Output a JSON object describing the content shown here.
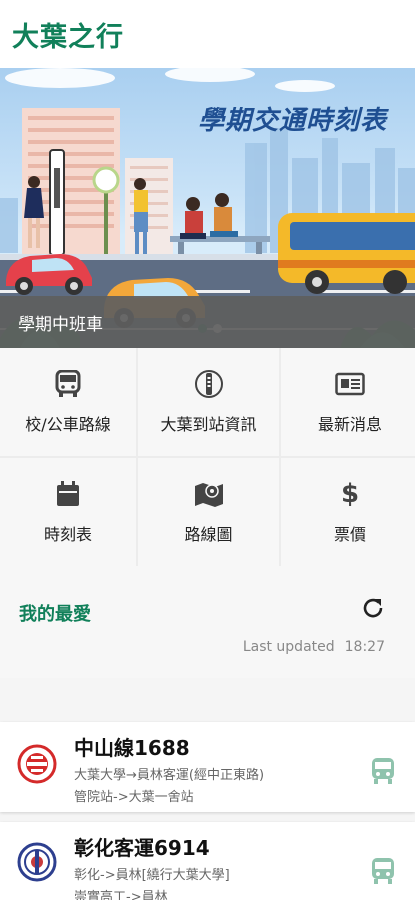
{
  "app": {
    "title": "大葉之行"
  },
  "banner": {
    "title": "學期交通時刻表",
    "caption": "學期中班車",
    "dots": [
      "inactive",
      "active"
    ]
  },
  "menu": [
    {
      "label": "校/公車路線",
      "icon": "bus-icon"
    },
    {
      "label": "大葉到站資訊",
      "icon": "bus-stop-icon"
    },
    {
      "label": "最新消息",
      "icon": "news-icon"
    },
    {
      "label": "時刻表",
      "icon": "calendar-icon"
    },
    {
      "label": "路線圖",
      "icon": "map-icon"
    },
    {
      "label": "票價",
      "icon": "dollar-icon"
    }
  ],
  "favorites": {
    "title": "我的最愛",
    "updated_label": "Last updated",
    "updated_time": "18:27",
    "items": [
      {
        "name": "中山線1688",
        "route": "大葉大學→員林客運(經中正東路)",
        "stops": "管院站->大葉一舍站",
        "logo": "red-bus-company-logo"
      },
      {
        "name": "彰化客運6914",
        "route": "彰化->員林[繞行大葉大學]",
        "stops": "崇實高工->員林",
        "logo": "blue-bus-company-logo"
      }
    ]
  },
  "colors": {
    "accent": "#11805a",
    "bus_icon": "#8fc3ad"
  }
}
